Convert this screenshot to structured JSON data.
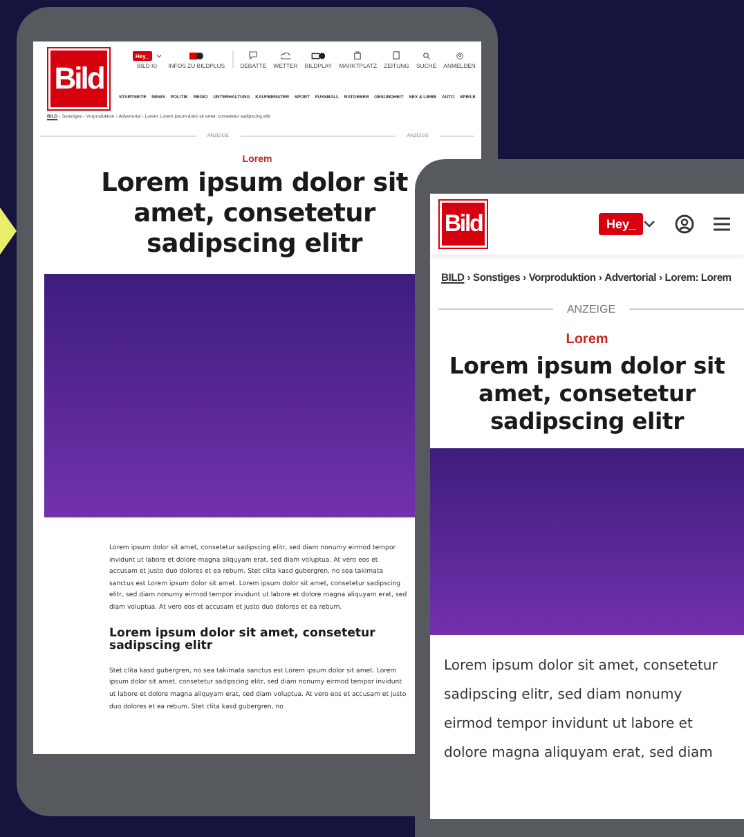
{
  "tablet": {
    "logo": "Bild",
    "ai_badge": "Hey_",
    "tools": [
      {
        "label": "BILD KI"
      },
      {
        "label": "INFOS ZU BILDPLUS"
      },
      {
        "label": "DEBATTE"
      },
      {
        "label": "WETTER"
      },
      {
        "label": "BILDPLAY"
      },
      {
        "label": "MARKTPLATZ"
      },
      {
        "label": "ZEITUNG"
      },
      {
        "label": "SUCHE"
      },
      {
        "label": "ANMELDEN"
      }
    ],
    "nav": [
      "STARTSEITE",
      "NEWS",
      "POLITIK",
      "REGIO",
      "UNTERHALTUNG",
      "KAUFBERATER",
      "SPORT",
      "FUSSBALL",
      "RATGEBER",
      "GESUNDHEIT",
      "SEX & LIEBE",
      "AUTO",
      "SPIELE"
    ],
    "breadcrumb": {
      "separator": "›",
      "items": [
        "BILD",
        "Sonstiges",
        "Vorproduktion",
        "Advertorial",
        "Lorem: Lorem ipsum dolor sit amet, consetetur sadipscing elitr"
      ]
    },
    "ad_labels": [
      "ANZEIGE",
      "ANZEIGE"
    ],
    "kicker": "Lorem",
    "title": "Lorem ipsum dolor sit amet, consetetur sadipscing elitr",
    "paragraph": "Lorem ipsum dolor sit amet, consetetur sadipscing elitr, sed diam nonumy eirmod tempor invidunt ut labore et dolore magna aliquyam erat, sed diam voluptua. At vero eos et accusam et justo duo dolores et ea rebum. Stet clita kasd gubergren, no sea takimata sanctus est Lorem ipsum dolor sit amet. Lorem ipsum dolor sit amet, consetetur sadipscing elitr, sed diam nonumy eirmod tempor invidunt ut labore et dolore magna aliquyam erat, sed diam voluptua. At vero eos et accusam et justo duo dolores et ea rebum.",
    "subheading": "Lorem ipsum dolor sit amet, consetetur sadipscing elitr",
    "paragraph_2": "Stet clita kasd gubergren, no sea takimata sanctus est Lorem ipsum dolor sit amet. Lorem ipsum dolor sit amet, consetetur sadipscing elitr, sed diam nonumy eirmod tempor invidunt ut labore et dolore magna aliquyam erat, sed diam voluptua. At vero eos et accusam et justo duo dolores et ea rebum. Stet clita kasd gubergren, no"
  },
  "phone": {
    "logo": "Bild",
    "ai_badge": "Hey_",
    "breadcrumb": {
      "separator": "›",
      "items": [
        "BILD",
        "Sonstiges",
        "Vorproduktion",
        "Advertorial",
        "Lorem: Lorem"
      ]
    },
    "ad_label": "ANZEIGE",
    "kicker": "Lorem",
    "title": "Lorem ipsum dolor sit amet, consetetur sadipscing elitr",
    "paragraph": "Lorem ipsum dolor sit amet, consetetur sadipscing elitr, sed diam nonumy eirmod tempor invidunt ut labore et dolore magna aliquyam erat, sed diam"
  }
}
